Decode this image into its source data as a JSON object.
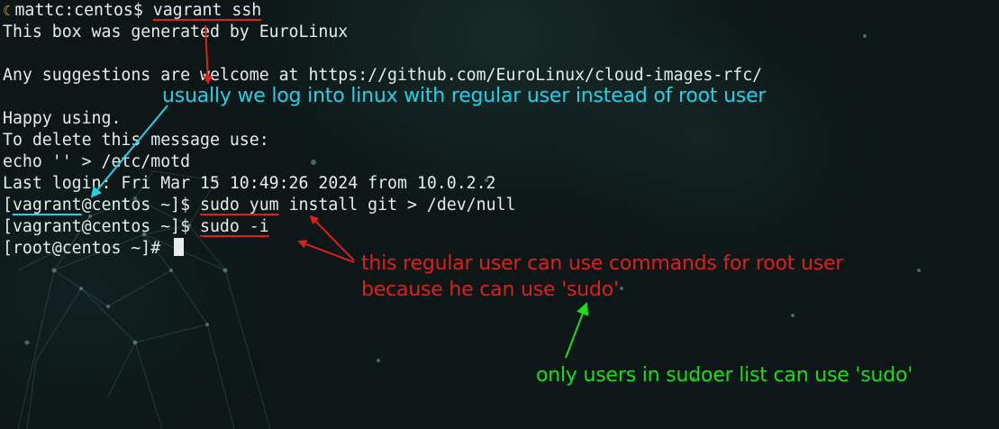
{
  "terminal": {
    "prompt_icon": "crescent-moon-icon",
    "lines": {
      "l1_prompt": "mattc:centos$ ",
      "l1_cmd": "vagrant ssh",
      "l2": "This box was generated by EuroLinux",
      "l3": "",
      "l4": "Any suggestions are welcome at https://github.com/EuroLinux/cloud-images-rfc/",
      "l5": "",
      "l6": "Happy using.",
      "l7": "To delete this message use:",
      "l8": "echo '' > /etc/motd",
      "l9": "Last login: Fri Mar 15 10:49:26 2024 from 10.0.2.2",
      "l10_open": "[",
      "l10_user": "vagrant",
      "l10_rest": "@centos ~]$ ",
      "l10_cmd": "sudo yum",
      "l10_tail": " install git > /dev/null",
      "l11_prompt": "[vagrant@centos ~]$ ",
      "l11_cmd": "sudo -i",
      "l12_prompt": "[root@centos ~]# "
    }
  },
  "annotations": {
    "cyan": "usually we log into linux with regular user instead of root user",
    "red_line1": "this regular user can use commands for root user",
    "red_line2": "because he can use 'sudo'",
    "green": "only users in sudoer list can use 'sudo'"
  },
  "colors": {
    "background": "#0d1717",
    "terminal_text": "#e6ecea",
    "annotation_cyan": "#1fd2e6",
    "annotation_red": "#e01e1e",
    "annotation_green": "#18e018"
  }
}
